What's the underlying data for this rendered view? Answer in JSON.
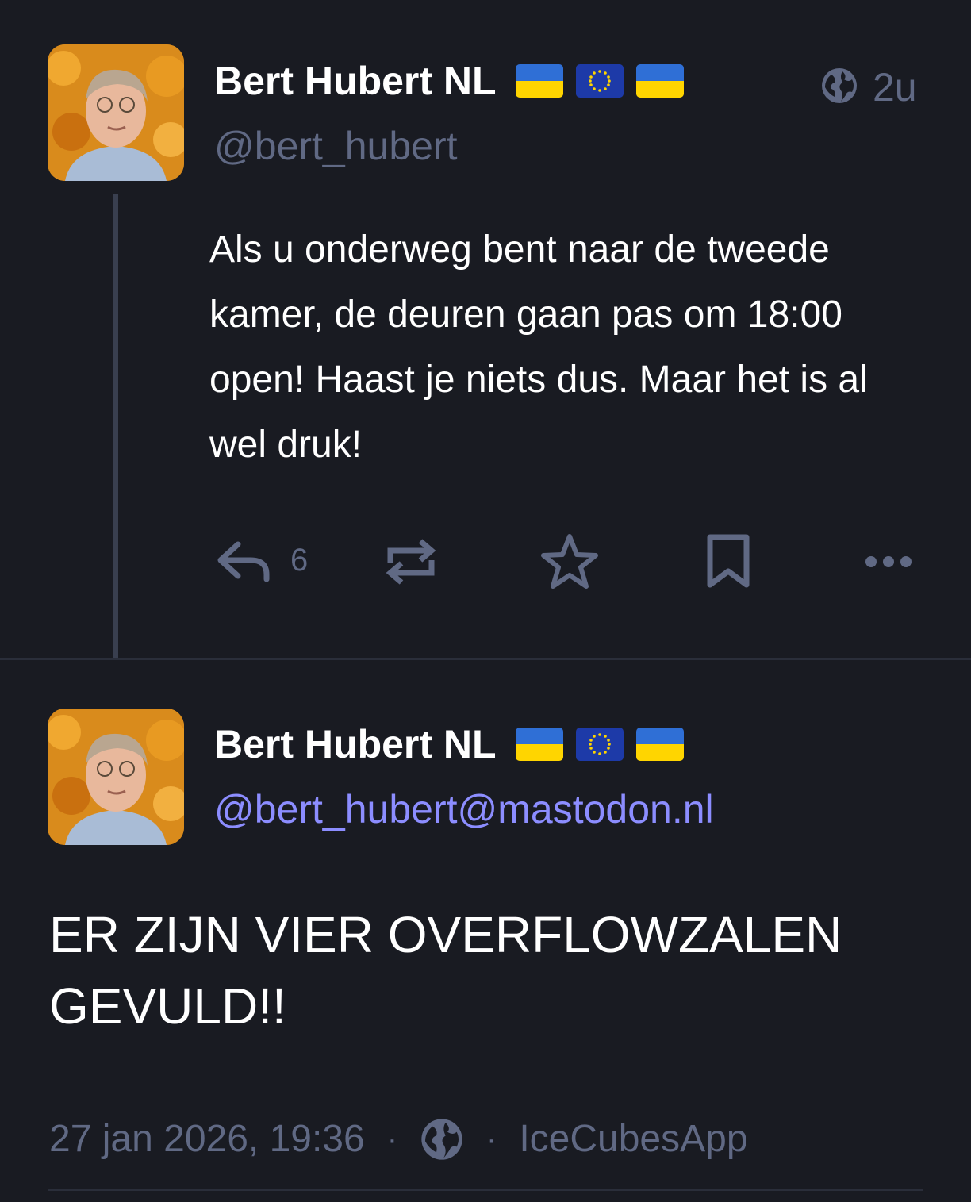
{
  "colors": {
    "background": "#191b22",
    "text": "#ffffff",
    "muted": "#606984",
    "accent": "#8c8dff",
    "thread_line": "#393f4f"
  },
  "post1": {
    "display_name": "Bert Hubert NL",
    "flags": [
      "ukraine-flag",
      "eu-flag",
      "ukraine-flag"
    ],
    "handle": "@bert_hubert",
    "visibility_icon": "globe-icon",
    "timestamp": "2u",
    "content": "Als u onderweg bent naar de tweede kamer, de deuren gaan pas om 18:00 open! Haast je niets dus. Maar het is al wel druk!",
    "actions": {
      "reply_icon": "reply-icon",
      "reply_count": "6",
      "boost_icon": "boost-icon",
      "favourite_icon": "star-icon",
      "bookmark_icon": "bookmark-icon",
      "more_icon": "more-icon"
    }
  },
  "post2": {
    "display_name": "Bert Hubert NL",
    "flags": [
      "ukraine-flag",
      "eu-flag",
      "ukraine-flag"
    ],
    "handle": "@bert_hubert@mastodon.nl",
    "content": "ER ZIJN VIER OVERFLOWZALEN GEVULD!!",
    "date": "27 jan 2026, 19:36",
    "separator": "·",
    "visibility_icon": "globe-icon",
    "app": "IceCubesApp"
  }
}
